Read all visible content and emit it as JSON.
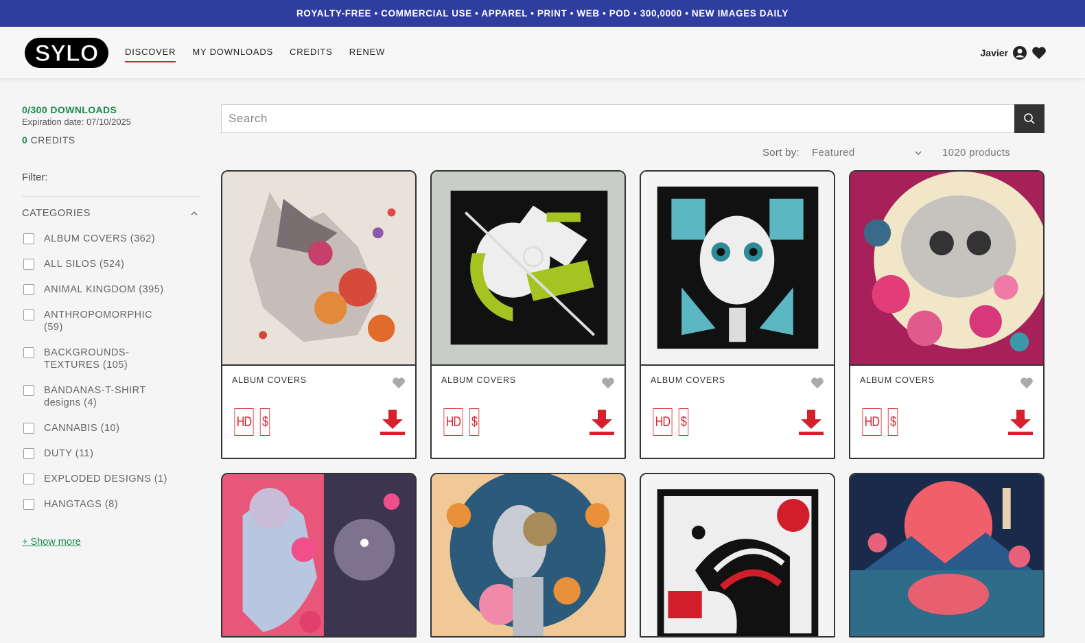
{
  "promo": "ROYALTY-FREE • COMMERCIAL USE • APPAREL • PRINT • WEB • POD • 300,0000 • NEW IMAGES DAILY",
  "logo_text": "SYLO",
  "nav": [
    "DISCOVER",
    "MY DOWNLOADS",
    "CREDITS",
    "RENEW"
  ],
  "user": {
    "name": "Javier",
    "icons": [
      "user-icon",
      "heart-icon"
    ]
  },
  "account": {
    "downloads": "0/300 DOWNLOADS",
    "expiration": "Expiration date: 07/10/2025",
    "credits_value": "0",
    "credits_label": " CREDITS"
  },
  "filter": {
    "label": "Filter:",
    "categories_title": "CATEGORIES",
    "categories": [
      "ALBUM COVERS (362)",
      "ALL SILOS (524)",
      "ANIMAL KINGDOM (395)",
      "ANTHROPOMORPHIC (59)",
      "BACKGROUNDS-TEXTURES (105)",
      "BANDANAS-T-SHIRT designs (4)",
      "CANNABIS (10)",
      "DUTY (11)",
      "EXPLODED DESIGNS (1)",
      "HANGTAGS (8)"
    ],
    "show_more": "+ Show more"
  },
  "search": {
    "placeholder": "Search"
  },
  "sort": {
    "label": "Sort by:",
    "selected": "Featured",
    "count": "1020 products"
  },
  "products": [
    {
      "category": "ALBUM COVERS",
      "badges": [
        "HD",
        "$"
      ]
    },
    {
      "category": "ALBUM COVERS",
      "badges": [
        "HD",
        "$"
      ]
    },
    {
      "category": "ALBUM COVERS",
      "badges": [
        "HD",
        "$"
      ]
    },
    {
      "category": "ALBUM COVERS",
      "badges": [
        "HD",
        "$"
      ]
    }
  ],
  "colors": {
    "promo_bg": "#2f3e9e",
    "accent_red": "#d6202b",
    "accent_green": "#1a8a4a"
  }
}
